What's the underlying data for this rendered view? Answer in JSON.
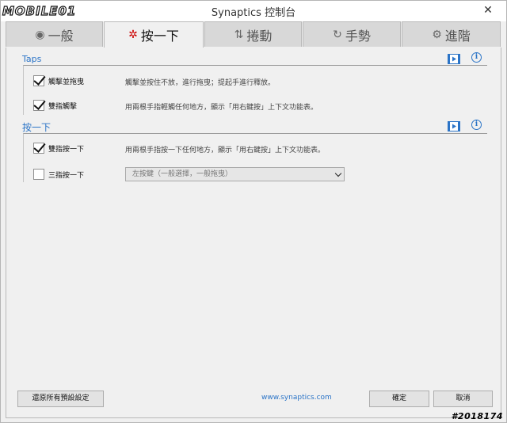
{
  "watermark": {
    "logo": "MOBILE01",
    "id": "#2018174"
  },
  "window": {
    "title": "Synaptics 控制台",
    "close_glyph": "✕"
  },
  "tabs": [
    {
      "label": "一般",
      "icon": "touchpad-icon",
      "glyph": "◉"
    },
    {
      "label": "按一下",
      "icon": "tap-sparkle-icon",
      "glyph": "✲"
    },
    {
      "label": "捲動",
      "icon": "scroll-arrows-icon",
      "glyph": "⇅"
    },
    {
      "label": "手勢",
      "icon": "gesture-icon",
      "glyph": "↻"
    },
    {
      "label": "進階",
      "icon": "gear-icon",
      "glyph": "⚙"
    }
  ],
  "active_tab": 1,
  "sections": {
    "taps": {
      "title": "Taps",
      "options": [
        {
          "label": "觸擊並拖曳",
          "checked": true,
          "description": "觸擊並按住不放，進行拖曳；提起手進行釋放。"
        },
        {
          "label": "雙指觸擊",
          "checked": true,
          "description": "用兩根手指輕觸任何地方，顯示「用右鍵按」上下文功能表。"
        }
      ]
    },
    "click": {
      "title": "按一下",
      "options": [
        {
          "label": "雙指按一下",
          "checked": true,
          "description": "用兩根手指按一下任何地方，顯示「用右鍵按」上下文功能表。"
        },
        {
          "label": "三指按一下",
          "checked": false,
          "select_value": "左按鍵（一般選擇，一般拖曳）"
        }
      ]
    }
  },
  "footer": {
    "restore_label": "還原所有預設設定",
    "link": "www.synaptics.com",
    "ok_label": "確定",
    "cancel_label": "取消"
  },
  "colors": {
    "accent": "#2b74c7",
    "active_tab_icon": "#cc0000",
    "background": "#f0f0f0"
  }
}
